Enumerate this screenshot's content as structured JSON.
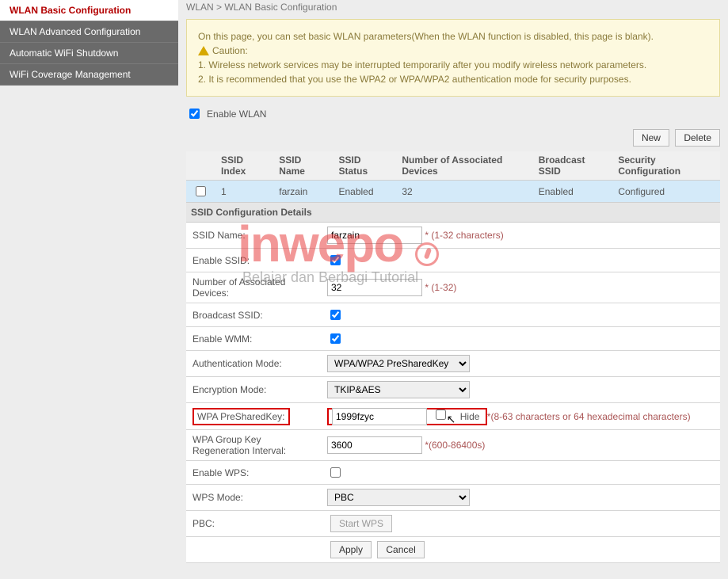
{
  "sidebar": {
    "items": [
      {
        "label": "WLAN Basic Configuration",
        "active": true
      },
      {
        "label": "WLAN Advanced Configuration",
        "active": false
      },
      {
        "label": "Automatic WiFi Shutdown",
        "active": false
      },
      {
        "label": "WiFi Coverage Management",
        "active": false
      }
    ]
  },
  "breadcrumb": "WLAN > WLAN Basic Configuration",
  "notice": {
    "intro": "On this page, you can set basic WLAN parameters(When the WLAN function is disabled, this page is blank).",
    "caution": "Caution:",
    "line1": "1. Wireless network services may be interrupted temporarily after you modify wireless network parameters.",
    "line2": "2. It is recommended that you use the WPA2 or WPA/WPA2 authentication mode for security purposes."
  },
  "enable_wlan_label": "Enable WLAN",
  "buttons": {
    "new": "New",
    "delete": "Delete",
    "apply": "Apply",
    "cancel": "Cancel",
    "start_wps": "Start WPS"
  },
  "table": {
    "headers": {
      "index": "SSID Index",
      "name": "SSID Name",
      "status": "SSID Status",
      "assoc": "Number of Associated Devices",
      "broadcast": "Broadcast SSID",
      "security": "Security Configuration"
    },
    "rows": [
      {
        "index": "1",
        "name": "farzain",
        "status": "Enabled",
        "assoc": "32",
        "broadcast": "Enabled",
        "security": "Configured"
      }
    ]
  },
  "section_title": "SSID Configuration Details",
  "form": {
    "ssid_name": {
      "label": "SSID Name:",
      "value": "farzain",
      "hint": "* (1-32 characters)"
    },
    "enable_ssid": {
      "label": "Enable SSID:"
    },
    "assoc": {
      "label": "Number of Associated Devices:",
      "value": "32",
      "hint": "* (1-32)"
    },
    "broadcast": {
      "label": "Broadcast SSID:"
    },
    "wmm": {
      "label": "Enable WMM:"
    },
    "auth_mode": {
      "label": "Authentication Mode:",
      "value": "WPA/WPA2 PreSharedKey"
    },
    "enc_mode": {
      "label": "Encryption Mode:",
      "value": "TKIP&AES"
    },
    "psk": {
      "label": "WPA PreSharedKey:",
      "value": "1999fzyc",
      "hide": "Hide",
      "hint": "*(8-63 characters or 64 hexadecimal characters)"
    },
    "rekey": {
      "label": "WPA Group Key Regeneration Interval:",
      "value": "3600",
      "hint": "*(600-86400s)"
    },
    "wps": {
      "label": "Enable WPS:"
    },
    "wps_mode": {
      "label": "WPS Mode:",
      "value": "PBC"
    },
    "pbc": {
      "label": "PBC:"
    }
  },
  "watermark": {
    "brand": "inwepo",
    "tagline": "Belajar dan Berbagi Tutorial"
  }
}
